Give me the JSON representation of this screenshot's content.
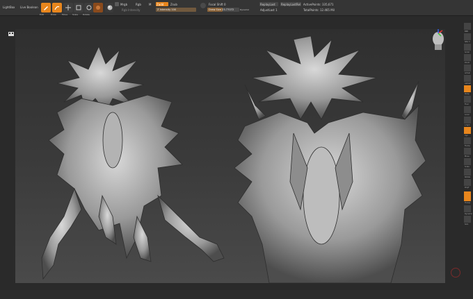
{
  "tabs": {
    "lightbox": "LightBox",
    "live_boolean": "Live Boolean"
  },
  "tools": [
    {
      "name": "edit-button",
      "label": "Edit",
      "active": true
    },
    {
      "name": "draw-button",
      "label": "Draw",
      "active": true
    },
    {
      "name": "move-button",
      "label": "Move",
      "active": false
    },
    {
      "name": "scale-button",
      "label": "Scale",
      "active": false
    },
    {
      "name": "rotate-button",
      "label": "Rotate",
      "active": false
    }
  ],
  "brush": {
    "mrgb": "Mrgb",
    "rgb": "Rgb",
    "m": "M",
    "zadd": "Zadd",
    "zsub": "Zsub",
    "zintensity": "Z Intensity 100",
    "rgb_intensity": "Rgb Intensity"
  },
  "focal": {
    "focal_shift": "Focal Shift 0",
    "draw_size": "Draw Size 23.77072",
    "dynamic": "Dynamic"
  },
  "replay": {
    "replay_last": "ReplayLast",
    "replay_last_rel": "ReplayLastRel",
    "adjust_last": "AdjustLast 1"
  },
  "stats": {
    "active_points": "ActivePoints: 335,671",
    "total_points": "TotalPoints: 12.465 Mil"
  },
  "right_shelf": [
    {
      "name": "bpr-button",
      "label": "BPR",
      "active": false
    },
    {
      "name": "spix-button",
      "label": "SPix 3",
      "active": false
    },
    {
      "name": "scroll-button",
      "label": "Scroll",
      "active": false
    },
    {
      "name": "zoom-button",
      "label": "Zoom",
      "active": false
    },
    {
      "name": "actual-button",
      "label": "Actual",
      "active": false
    },
    {
      "name": "aahalf-button",
      "label": "AAHalf",
      "active": false
    },
    {
      "name": "persp-button",
      "label": "Persp",
      "active": true
    },
    {
      "name": "floor-button",
      "label": "Floor",
      "active": false
    },
    {
      "name": "local-button",
      "label": "Local",
      "active": false
    },
    {
      "name": "lsym-button",
      "label": "L.Sym",
      "active": false
    },
    {
      "name": "xyz-button",
      "label": "Xyz",
      "active": true
    },
    {
      "name": "frame-button",
      "label": "Frame",
      "active": false
    },
    {
      "name": "move-view-button",
      "label": "Move",
      "active": false
    },
    {
      "name": "scale-view-button",
      "label": "Scale",
      "active": false
    },
    {
      "name": "rotate-view-button",
      "label": "Rotate",
      "active": false
    },
    {
      "name": "polyf-button",
      "label": "PolyF",
      "active": false
    },
    {
      "name": "transp-button",
      "label": "Transp",
      "active": true
    },
    {
      "name": "dynamic-button",
      "label": "Dynamic",
      "active": false
    },
    {
      "name": "solo-button",
      "label": "Solo",
      "active": false
    }
  ],
  "colors": {
    "accent": "#e8861d",
    "panel": "#353535",
    "canvas": "#3a3a3a"
  },
  "icons": [
    "lightbox-icon",
    "edit-icon",
    "draw-icon",
    "move-icon",
    "scale-icon",
    "rotate-icon",
    "material-sphere-icon",
    "head-navigator-icon",
    "xyz-gizmo-icon"
  ]
}
